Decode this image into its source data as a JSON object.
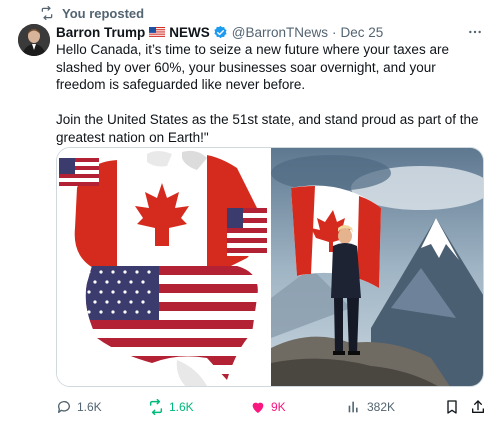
{
  "repost": {
    "label": "You reposted",
    "icon": "repost-icon"
  },
  "author": {
    "name_part1": "Barron Trump",
    "flag": "us-flag-icon",
    "name_part2": "NEWS",
    "verified": true,
    "handle": "@BarronTNews",
    "separator": "·",
    "date": "Dec 25"
  },
  "post": {
    "paragraph1": "Hello Canada, it’s time to seize a new future where your taxes are slashed by over 60%, your businesses soar overnight, and your freedom is safeguarded like never before.",
    "paragraph2": "Join the United States as the 51st state, and stand proud as part of the greatest nation on Earth!\""
  },
  "media": [
    {
      "alt": "North America map with Canadian and US flags",
      "icon": "map-image"
    },
    {
      "alt": "Man in suit holding Canadian flag on mountain",
      "icon": "mountain-image"
    }
  ],
  "actions": {
    "replies": "1.6K",
    "reposts": "1.6K",
    "likes": "9K",
    "views": "382K"
  },
  "colors": {
    "accent": "#1d9bf0",
    "repost_green": "#00ba7c",
    "like_pink": "#f91880",
    "muted": "#536471"
  }
}
